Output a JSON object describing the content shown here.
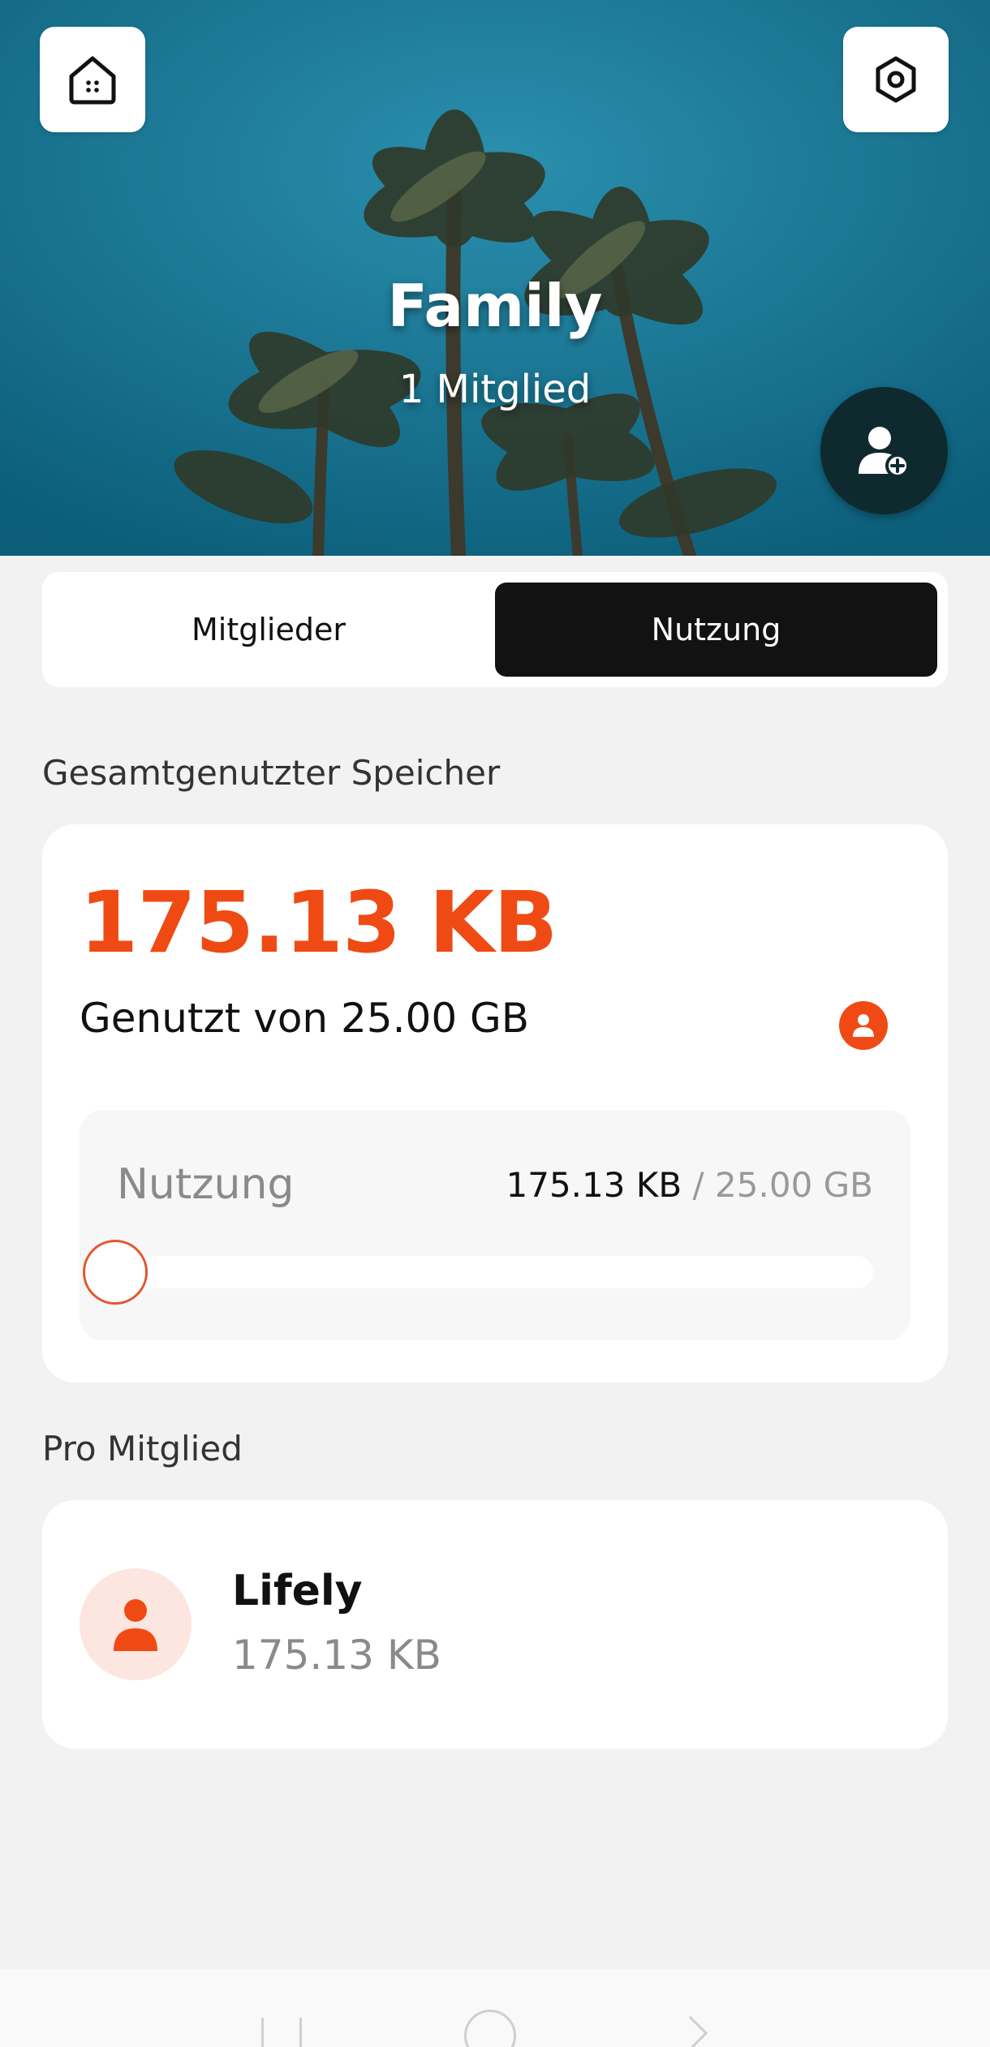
{
  "header": {
    "group_name": "Family",
    "member_count": "1 Mitglied"
  },
  "icons": {
    "home": "home-icon",
    "settings": "gear-hex-icon",
    "add_member": "add-user-icon"
  },
  "tabs": [
    {
      "label": "Mitglieder",
      "active": false
    },
    {
      "label": "Nutzung",
      "active": true
    }
  ],
  "storage": {
    "section_label": "Gesamtgenutzter Speicher",
    "used_value": "175.13 KB",
    "used_of": "Genutzt von 25.00 GB",
    "usage_label": "Nutzung",
    "usage_current": "175.13 KB",
    "usage_separator": "/",
    "usage_max": "25.00 GB",
    "usage_fraction": 1e-05
  },
  "per_member": {
    "section_label": "Pro Mitglied",
    "members": [
      {
        "name": "Lifely",
        "size": "175.13 KB"
      }
    ]
  },
  "colors": {
    "accent": "#f04a14",
    "tab_active_bg": "#121212",
    "background": "#f2f2f2"
  }
}
